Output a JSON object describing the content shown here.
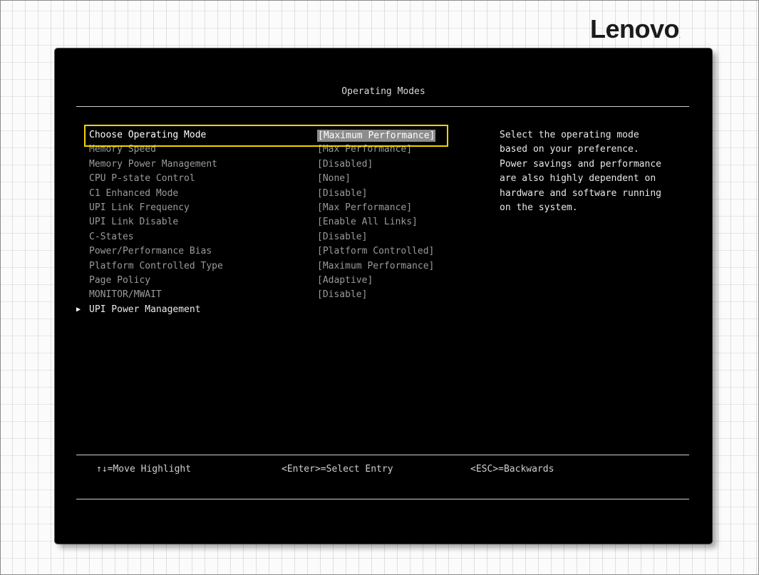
{
  "brand": {
    "logo_text": "Lenovo",
    "logo_mark": "."
  },
  "screen": {
    "title": "Operating Modes",
    "menu_items": [
      {
        "label": "Choose Operating Mode",
        "value": "[Maximum Performance]",
        "selected": true
      },
      {
        "label": "Memory Speed",
        "value": "[Max Performance]"
      },
      {
        "label": "Memory Power Management",
        "value": "[Disabled]"
      },
      {
        "label": "CPU P-state Control",
        "value": "[None]"
      },
      {
        "label": "C1 Enhanced Mode",
        "value": "[Disable]"
      },
      {
        "label": "UPI Link Frequency",
        "value": "[Max Performance]"
      },
      {
        "label": "UPI Link Disable",
        "value": "[Enable All Links]"
      },
      {
        "label": "C-States",
        "value": "[Disable]"
      },
      {
        "label": "Power/Performance Bias",
        "value": "[Platform Controlled]"
      },
      {
        "label": "Platform Controlled Type",
        "value": "[Maximum Performance]"
      },
      {
        "label": "Page Policy",
        "value": "[Adaptive]"
      },
      {
        "label": "MONITOR/MWAIT",
        "value": "[Disable]"
      },
      {
        "label": "UPI Power Management",
        "value": "",
        "submenu": true
      }
    ],
    "help_lines": [
      "Select the operating mode",
      "based on your preference.",
      "Power savings and performance",
      "are also highly dependent on",
      "hardware and software running",
      "on the system."
    ]
  },
  "footer": {
    "move_hint": "↑↓=Move Highlight",
    "select_hint": "<Enter>=Select Entry",
    "back_hint": "<ESC>=Backwards"
  },
  "colors": {
    "highlight_border": "#f0d400",
    "selected_value_bg": "#8c8c8c",
    "screen_bg": "#000000"
  },
  "icons": {
    "submenu_marker": "triangle-right-icon"
  }
}
